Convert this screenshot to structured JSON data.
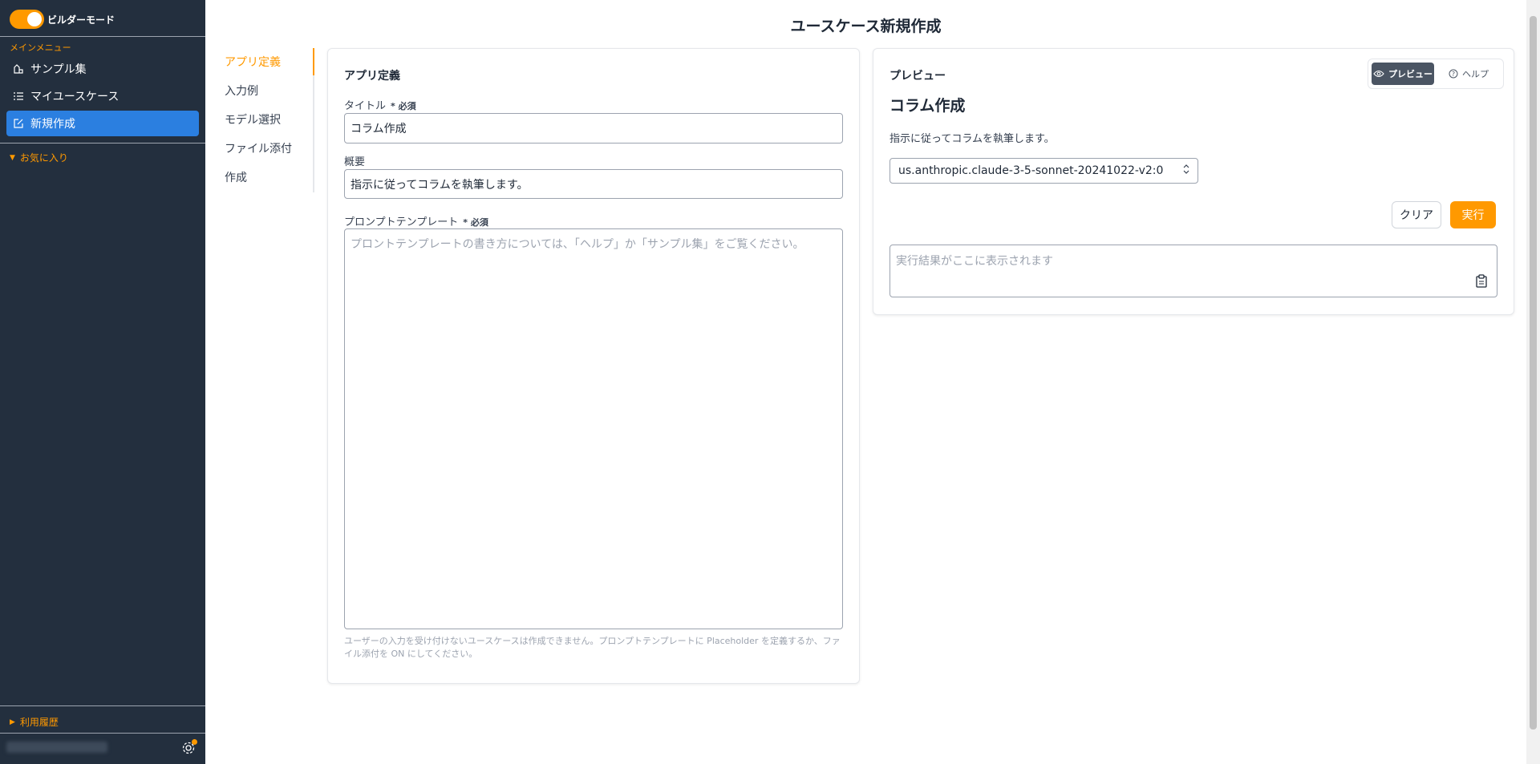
{
  "sidebar": {
    "builder_mode_label": "ビルダーモード",
    "main_menu_label": "メインメニュー",
    "items": [
      {
        "label": "サンプル集",
        "icon": "samples-icon"
      },
      {
        "label": "マイユースケース",
        "icon": "list-icon"
      },
      {
        "label": "新規作成",
        "icon": "edit-icon"
      }
    ],
    "favorites_label": "お気に入り",
    "history_label": "利用履歴"
  },
  "header": {
    "title": "ユースケース新規作成"
  },
  "steps": [
    "アプリ定義",
    "入力例",
    "モデル選択",
    "ファイル添付",
    "作成"
  ],
  "definition": {
    "card_title": "アプリ定義",
    "title_label": "タイトル",
    "required_mark": "* 必須",
    "title_value": "コラム作成",
    "summary_label": "概要",
    "summary_value": "指示に従ってコラムを執筆します。",
    "prompt_label": "プロンプトテンプレート",
    "prompt_placeholder": "プロントテンプレートの書き方については、「ヘルプ」か「サンプル集」をご覧ください。",
    "helper_text": "ユーザーの入力を受け付けないユースケースは作成できません。プロンプトテンプレートに Placeholder を定義するか、ファイル添付を ON にしてください。"
  },
  "preview": {
    "card_title": "プレビュー",
    "preview_tab": "プレビュー",
    "help_tab": "ヘルプ",
    "app_title": "コラム作成",
    "app_description": "指示に従ってコラムを執筆します。",
    "model": "us.anthropic.claude-3-5-sonnet-20241022-v2:0",
    "clear_label": "クリア",
    "run_label": "実行",
    "result_placeholder": "実行結果がここに表示されます"
  },
  "colors": {
    "accent": "#ff9900",
    "sidebar_bg": "#232f3e",
    "active_nav": "#2b7fe0"
  }
}
